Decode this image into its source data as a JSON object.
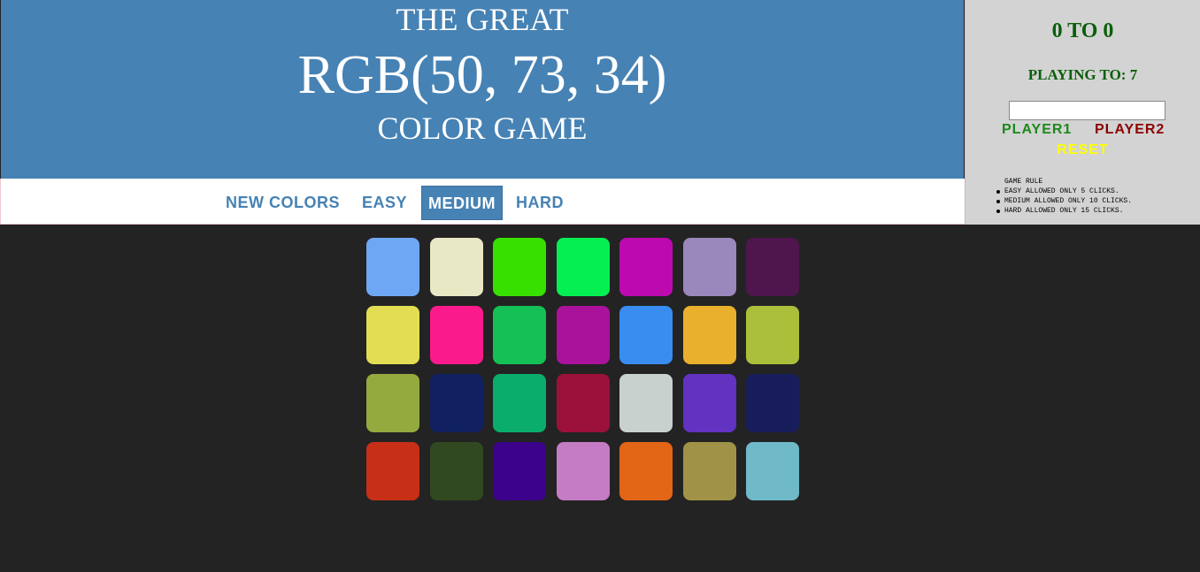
{
  "header": {
    "line1": "THE GREAT",
    "line2": "RGB(50, 73, 34)",
    "line3": "COLOR GAME",
    "background": "#4682b4"
  },
  "stripe": {
    "new_colors": "NEW COLORS",
    "easy": "EASY",
    "medium": "MEDIUM",
    "hard": "HARD",
    "selected": "MEDIUM"
  },
  "panel": {
    "score": "0 TO 0",
    "playing_to": "PLAYING TO: 7",
    "player1": "PLAYER1",
    "player2": "PLAYER2",
    "reset": "RESET",
    "rule_title": "GAME RULE",
    "rules": [
      "EASY ALLOWED ONLY 5 CLICKS.",
      "MEDIUM ALLOWED ONLY 10 CLICKS.",
      "HARD ALLOWED ONLY 15 CLICKS."
    ]
  },
  "squares": [
    [
      "#6ea8f5",
      "#e8e8c4",
      "#38e000",
      "#05ef52",
      "#bd0aae",
      "#9a87bc",
      "#4e164d"
    ],
    [
      "#e2dd52",
      "#fa1a8c",
      "#14c156",
      "#ab129c",
      "#398cf0",
      "#e9b02e",
      "#abbf3a"
    ],
    [
      "#95aa3e",
      "#112060",
      "#0aad6b",
      "#9b113a",
      "#c9d1cf",
      "#6232c1",
      "#171c5a"
    ],
    [
      "#c72f16",
      "#304921",
      "#3c028b",
      "#c67bc5",
      "#e36516",
      "#a09347",
      "#6fb9c9"
    ]
  ]
}
